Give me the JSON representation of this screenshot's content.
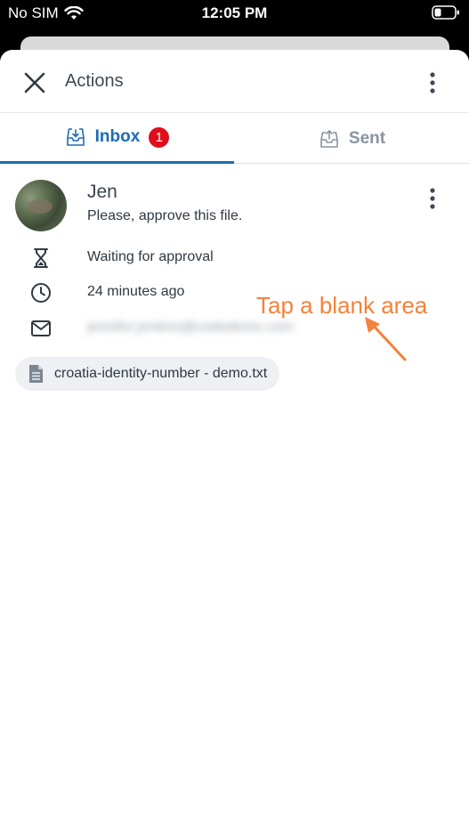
{
  "status_bar": {
    "carrier": "No SIM",
    "time": "12:05 PM"
  },
  "header": {
    "title": "Actions"
  },
  "tabs": [
    {
      "label": "Inbox",
      "badge": "1",
      "active": true
    },
    {
      "label": "Sent",
      "active": false
    }
  ],
  "message": {
    "sender": "Jen",
    "text": "Please, approve this file.",
    "status": "Waiting for approval",
    "time_ago": "24 minutes ago",
    "email": "jennifer.jenkins@codedemo.com"
  },
  "file": {
    "name": "croatia-identity-number - demo.txt"
  },
  "annotation": {
    "text": "Tap a blank area",
    "color": "#f3823c"
  },
  "colors": {
    "accent": "#1d6bb5",
    "badge": "#e00d1c"
  }
}
